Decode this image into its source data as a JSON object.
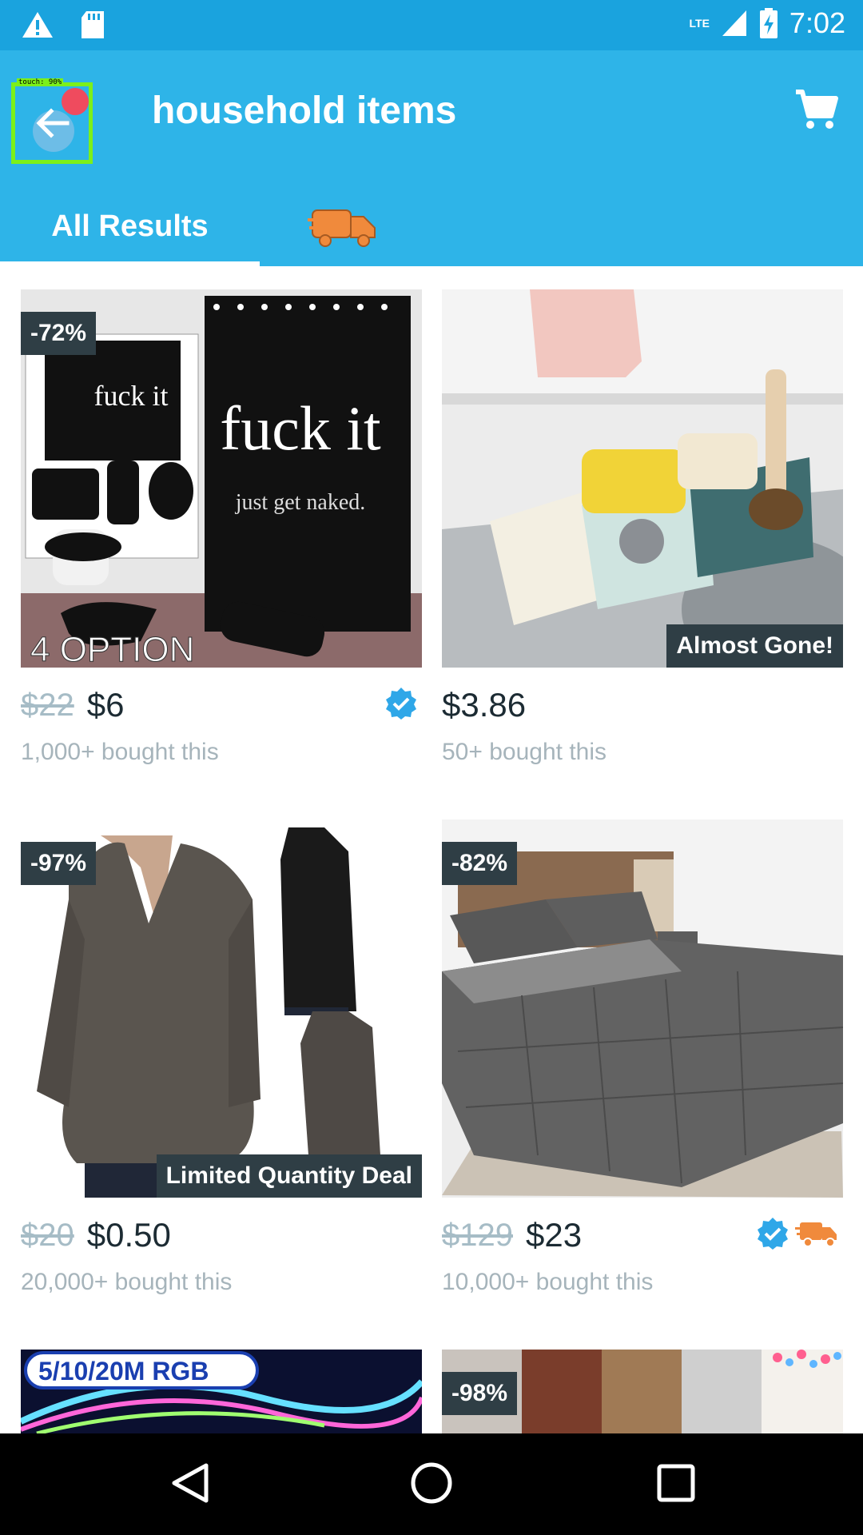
{
  "status_bar": {
    "time": "7:02",
    "network": "LTE",
    "icons": [
      "warning-icon",
      "sd-card-icon",
      "signal-icon",
      "battery-charging-icon"
    ]
  },
  "app_bar": {
    "title": "household items",
    "back_icon": "arrow-left-icon",
    "touch_debug_label": "touch: 90%",
    "cart_icon": "cart-icon"
  },
  "tabs": {
    "all_results": "All Results",
    "shipping_tab_icon": "fast-delivery-truck-icon"
  },
  "colors": {
    "status_bar": "#1aa3de",
    "app_bar": "#2eb4e8",
    "discount_badge": "#2f3e45",
    "verified": "#2fa7e8",
    "delivery_truck": "#f08a3c"
  },
  "products": [
    {
      "discount": "-72%",
      "image_text": "fuck it",
      "image_subtext": "just get naked.",
      "image_caption": "4 OPTION",
      "old_price": "$22",
      "price": "$6",
      "bought": "1,000+ bought this",
      "badges": [
        "verified-icon"
      ]
    },
    {
      "bottom_badge": "Almost Gone!",
      "price": "$3.86",
      "bought": "50+ bought this",
      "badges": []
    },
    {
      "discount": "-97%",
      "bottom_badge": "Limited Quantity Deal",
      "old_price": "$20",
      "price": "$0.50",
      "bought": "20,000+ bought this",
      "badges": []
    },
    {
      "discount": "-82%",
      "old_price": "$129",
      "price": "$23",
      "bought": "10,000+ bought this",
      "badges": [
        "verified-icon",
        "delivery-truck-icon"
      ]
    },
    {
      "image_banner": "5/10/20M RGB"
    },
    {
      "discount": "-98%"
    }
  ],
  "nav_bar": {
    "icons": [
      "back-triangle-icon",
      "home-circle-icon",
      "recents-square-icon"
    ]
  }
}
